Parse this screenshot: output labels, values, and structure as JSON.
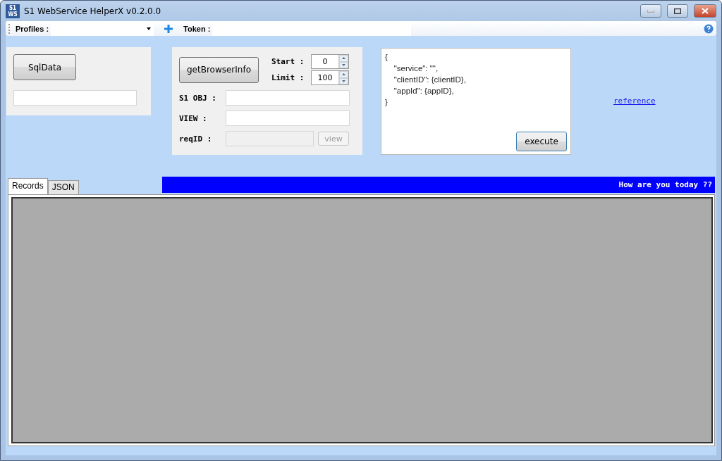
{
  "window": {
    "title": "S1 WebService HelperX v0.2.0.0",
    "app_icon_text": "S1\nWS"
  },
  "toolbar": {
    "profiles_label": "Profiles :",
    "token_label": "Token :"
  },
  "sql_panel": {
    "button": "SqlData"
  },
  "browser_panel": {
    "button": "getBrowserInfo",
    "spinners": [
      {
        "label": "Start :",
        "value": "0"
      },
      {
        "label": "Limit :",
        "value": "100"
      }
    ],
    "fields": [
      {
        "label": "S1 OBJ :",
        "disabled": false
      },
      {
        "label": "VIEW :",
        "disabled": false
      },
      {
        "label": "reqID :",
        "disabled": true
      }
    ],
    "view_button": {
      "label": "view",
      "disabled": true
    }
  },
  "editor": {
    "lines": [
      "{",
      "    \"service\": \"\",",
      "    \"clientID\": {clientID},",
      "    \"appId\": {appID},",
      "}"
    ],
    "button": "execute"
  },
  "reference_link": "reference",
  "tabs": [
    {
      "label": "Records",
      "selected": true
    },
    {
      "label": "JSON",
      "selected": false
    }
  ],
  "status_message": "How are you today ??"
}
